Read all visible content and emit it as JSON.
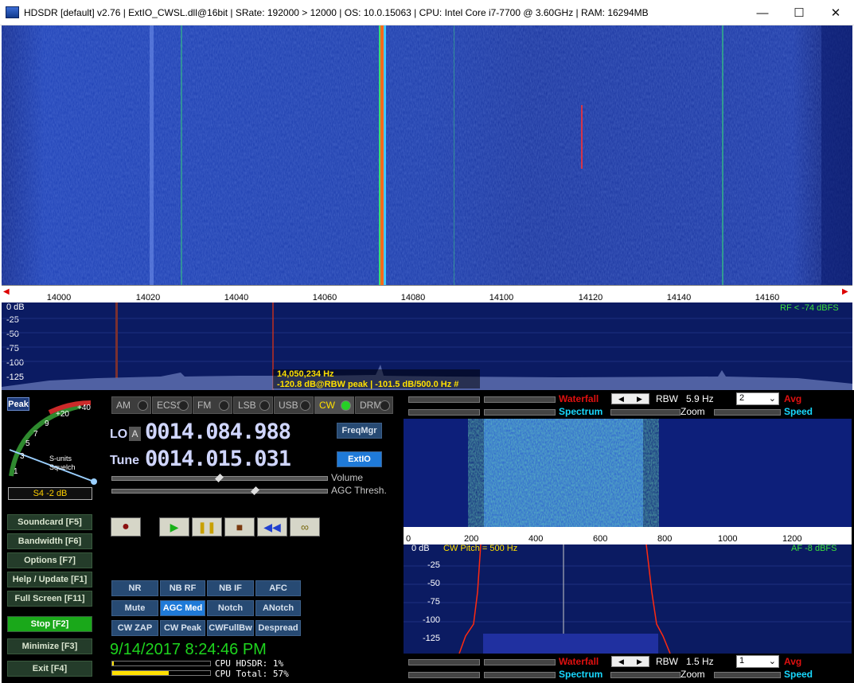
{
  "title": "HDSDR  [default]  v2.76   |  ExtIO_CWSL.dll@16bit  |  SRate: 192000 > 12000  |  OS: 10.0.15063   |  CPU: Intel Core i7-7700 @ 3.60GHz  |  RAM: 16294MB",
  "window": {
    "minimize": "—",
    "maximize": "☐",
    "close": "✕"
  },
  "scale": {
    "ticks": [
      "14000",
      "14020",
      "14040",
      "14060",
      "14080",
      "14100",
      "14120",
      "14140",
      "14160"
    ]
  },
  "spectrum": {
    "db_labels": [
      "0 dB",
      "-25",
      "-50",
      "-75",
      "-100",
      "-125"
    ],
    "rf_level": "RF < -74 dBFS",
    "freq_readout": "14,050,234 Hz",
    "peak_readout": "-120.8 dB@RBW peak | -101.5 dB/500.0 Hz #"
  },
  "smeter": {
    "peak": "Peak",
    "scale": [
      "1",
      "3",
      "5",
      "7",
      "9",
      "+20",
      "+40"
    ],
    "caption1": "S-units",
    "caption2": "Squelch",
    "reading": "S4 -2 dB"
  },
  "modes": [
    "AM",
    "ECSS",
    "FM",
    "LSB",
    "USB",
    "CW",
    "DRM"
  ],
  "lo": {
    "label": "LO",
    "a": "A",
    "value": "0014.084.988"
  },
  "tune": {
    "label": "Tune",
    "value": "0014.015.031"
  },
  "freqmgr": "FreqMgr",
  "extio": "ExtIO",
  "volume": "Volume",
  "agc_thresh": "AGC Thresh.",
  "left_buttons": [
    "Soundcard  [F5]",
    "Bandwidth  [F6]",
    "Options  [F7]",
    "Help / Update  [F1]",
    "Full Screen  [F11]",
    "Stop  [F2]",
    "Minimize  [F3]",
    "Exit  [F4]"
  ],
  "dsp": [
    "NR",
    "NB RF",
    "NB IF",
    "AFC",
    "Mute",
    "AGC Med",
    "Notch",
    "ANotch",
    "CW ZAP",
    "CW Peak",
    "CWFullBw",
    "Despread"
  ],
  "datetime": "9/14/2017 8:24:46 PM",
  "cpu": {
    "hdsdr": "CPU HDSDR:  1%",
    "total": "CPU Total:  57%"
  },
  "top_controls": {
    "waterfall": "Waterfall",
    "spectrum": "Spectrum",
    "rbw": "RBW",
    "rbw_value": "5.9 Hz",
    "avg_select": "2",
    "avg": "Avg",
    "zoom": "Zoom",
    "speed": "Speed"
  },
  "af": {
    "ticks": [
      "0",
      "200",
      "400",
      "600",
      "800",
      "1000",
      "1200"
    ],
    "db_labels": [
      "0 dB",
      "-25",
      "-50",
      "-75",
      "-100",
      "-125"
    ],
    "cw_pitch": "CW Pitch = 500 Hz",
    "af_level": "AF  -8 dBFS"
  },
  "bottom_controls": {
    "waterfall": "Waterfall",
    "spectrum": "Spectrum",
    "rbw": "RBW",
    "rbw_value": "1.5 Hz",
    "avg_select": "1",
    "avg": "Avg",
    "zoom": "Zoom",
    "speed": "Speed"
  }
}
